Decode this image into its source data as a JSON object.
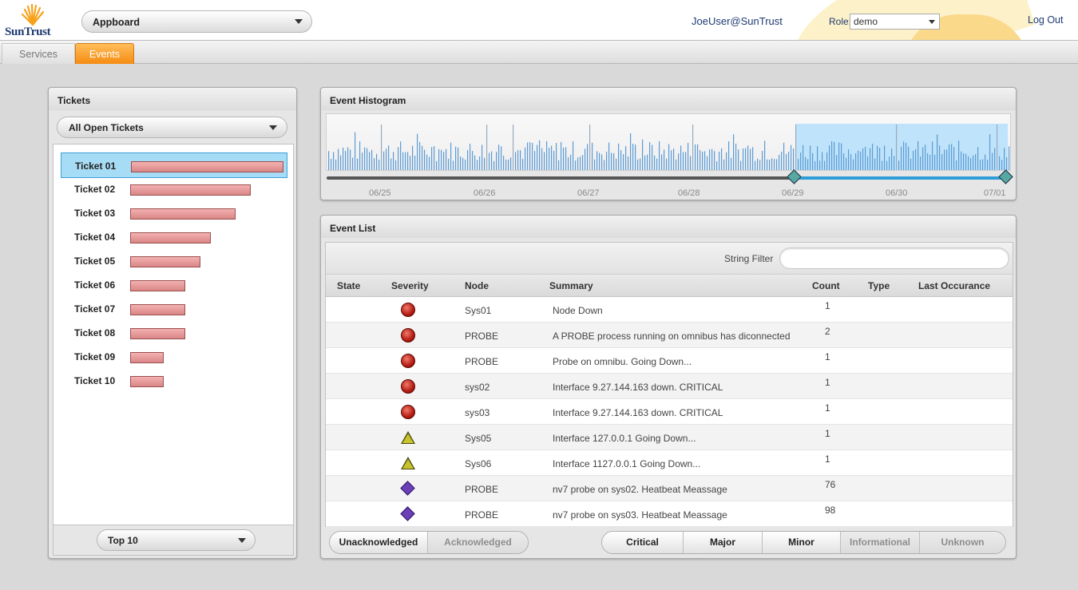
{
  "header": {
    "logo_text": "SunTrust",
    "app_selector": "Appboard",
    "user": "JoeUser@SunTrust",
    "role_label": "Role:",
    "role_value": "demo",
    "logout": "Log Out"
  },
  "tabs": [
    {
      "label": "Services",
      "active": false
    },
    {
      "label": "Events",
      "active": true
    }
  ],
  "tickets": {
    "title": "Tickets",
    "filter": "All Open Tickets",
    "items": [
      {
        "label": "Ticket 01",
        "level": 1.0,
        "selected": true
      },
      {
        "label": "Ticket 02",
        "level": 0.79
      },
      {
        "label": "Ticket 03",
        "level": 0.69
      },
      {
        "label": "Ticket 04",
        "level": 0.53
      },
      {
        "label": "Ticket 05",
        "level": 0.46
      },
      {
        "label": "Ticket 06",
        "level": 0.36
      },
      {
        "label": "Ticket 07",
        "level": 0.36
      },
      {
        "label": "Ticket 08",
        "level": 0.36
      },
      {
        "label": "Ticket 09",
        "level": 0.22
      },
      {
        "label": "Ticket 10",
        "level": 0.22
      }
    ],
    "footer_select": "Top 10"
  },
  "histogram": {
    "title": "Event Histogram",
    "dates": [
      "06/25",
      "06/26",
      "06/27",
      "06/28",
      "06/29",
      "06/30",
      "07/01"
    ],
    "selection": {
      "from": "06/29",
      "to": "07/01"
    }
  },
  "event_list": {
    "title": "Event List",
    "filter_label": "String Filter",
    "filter_value": "",
    "columns": [
      "State",
      "Severity",
      "Node",
      "Summary",
      "Count",
      "Type",
      "Last Occurance"
    ],
    "rows": [
      {
        "state": "",
        "severity": "critical",
        "node": "Sys01",
        "summary": "Node Down",
        "count": "1",
        "type": "",
        "last": ""
      },
      {
        "state": "",
        "severity": "critical",
        "node": "PROBE",
        "summary": "A PROBE process running on omnibus has diconnected",
        "count": "2",
        "type": "",
        "last": ""
      },
      {
        "state": "",
        "severity": "critical",
        "node": "PROBE",
        "summary": "Probe on omnibu.  Going Down...",
        "count": "1",
        "type": "",
        "last": ""
      },
      {
        "state": "",
        "severity": "critical",
        "node": "sys02",
        "summary": "Interface 9.27.144.163 down.  CRITICAL",
        "count": "1",
        "type": "",
        "last": ""
      },
      {
        "state": "",
        "severity": "critical",
        "node": "sys03",
        "summary": "Interface 9.27.144.163 down.  CRITICAL",
        "count": "1",
        "type": "",
        "last": ""
      },
      {
        "state": "",
        "severity": "minor",
        "node": "Sys05",
        "summary": "Interface 127.0.0.1 Going Down...",
        "count": "1",
        "type": "",
        "last": ""
      },
      {
        "state": "",
        "severity": "minor",
        "node": "Sys06",
        "summary": "Interface 1127.0.0.1 Going Down...",
        "count": "1",
        "type": "",
        "last": ""
      },
      {
        "state": "",
        "severity": "info",
        "node": "PROBE",
        "summary": "nv7 probe on sys02. Heatbeat Meassage",
        "count": "76",
        "type": "",
        "last": ""
      },
      {
        "state": "",
        "severity": "info",
        "node": "PROBE",
        "summary": "nv7 probe on sys03. Heatbeat Meassage",
        "count": "98",
        "type": "",
        "last": ""
      }
    ],
    "ack_toggle": [
      {
        "label": "Unacknowledged",
        "on": true
      },
      {
        "label": "Acknowledged",
        "on": false
      }
    ],
    "severity_toggle": [
      {
        "label": "Critical",
        "on": true
      },
      {
        "label": "Major",
        "on": true
      },
      {
        "label": "Minor",
        "on": true
      },
      {
        "label": "Informational",
        "on": false
      },
      {
        "label": "Unknown",
        "on": false
      }
    ]
  },
  "colors": {
    "accent": "#f58c12",
    "selected_ticket": "#a7dcf6",
    "ticket_bar": "#e8a0a0",
    "histogram_bar": "#5b9bd5",
    "histogram_selection": "#bfe3fa",
    "critical": "#b51b12",
    "minor": "#c7c32b",
    "info": "#6a3fb8"
  }
}
